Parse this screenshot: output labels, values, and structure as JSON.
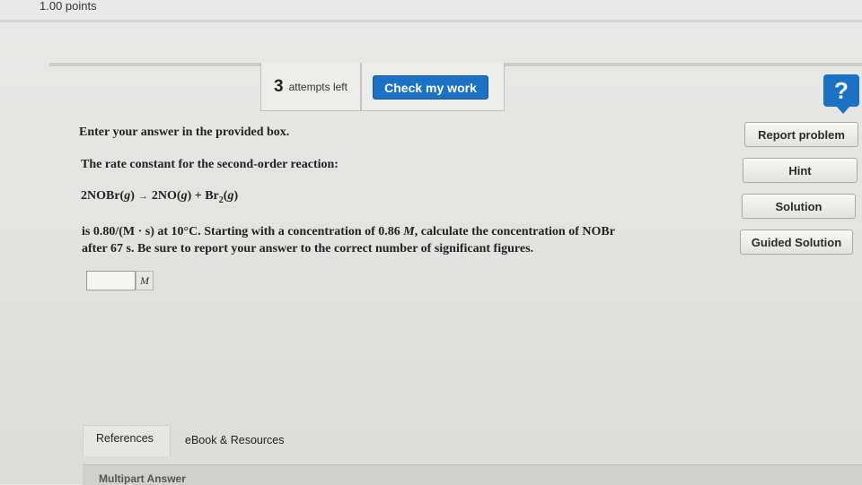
{
  "header": {
    "points": "1.00 points"
  },
  "toolbar": {
    "attempts_count": "3",
    "attempts_label": "attempts left",
    "check_label": "Check my work",
    "help_glyph": "?"
  },
  "sidebar": {
    "buttons": [
      {
        "label": "Report problem"
      },
      {
        "label": "Hint"
      },
      {
        "label": "Solution"
      },
      {
        "label": "Guided Solution"
      }
    ]
  },
  "question": {
    "instruction": "Enter your answer in the provided box.",
    "intro": "The rate constant for the second-order reaction:",
    "equation": {
      "left": "2NOBr(",
      "left_phase": "g",
      "arrow": "→",
      "right1": "2NO(",
      "right1_phase": "g",
      "plus": "+ Br",
      "sub": "2",
      "right2_open": "(",
      "right2_phase": "g",
      "close": ")"
    },
    "body_a": "is 0.80/(M · s) at 10°C. Starting with a concentration of 0.86 ",
    "body_m": "M",
    "body_b": ", calculate the concentration of NOBr",
    "body_line2": "after 67 s. Be sure to report your answer to the correct number of significant figures.",
    "answer_value": "",
    "answer_unit": "M"
  },
  "footer": {
    "tabs": [
      {
        "label": "References"
      },
      {
        "label": "eBook & Resources"
      }
    ],
    "multipart": "Multipart Answer"
  },
  "colors": {
    "accent": "#1d71c4",
    "background": "#e6e6e3"
  }
}
